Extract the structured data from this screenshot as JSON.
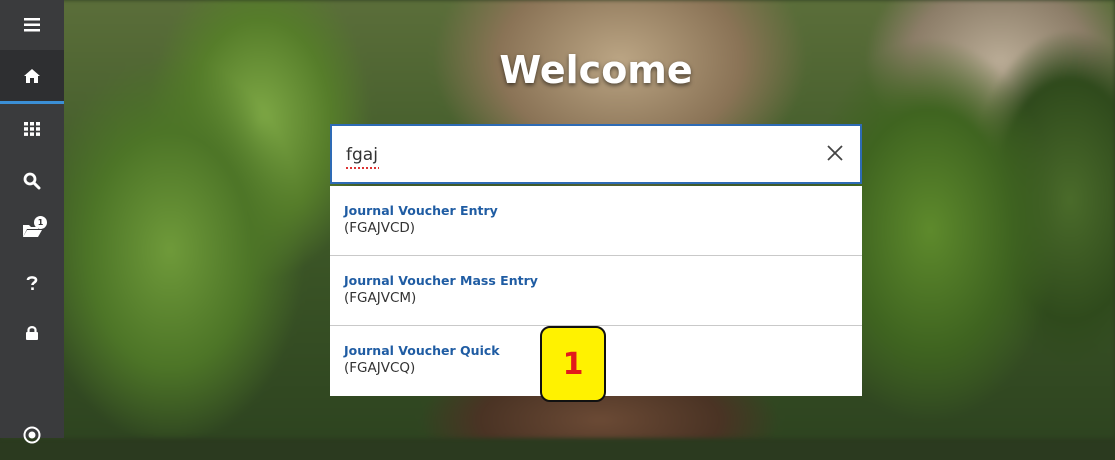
{
  "page": {
    "welcome_title": "Welcome"
  },
  "search": {
    "value": "fgaj",
    "clear_label": "×"
  },
  "results": [
    {
      "title": "Journal Voucher Entry",
      "code": "(FGAJVCD)"
    },
    {
      "title": "Journal Voucher Mass Entry",
      "code": "(FGAJVCM)"
    },
    {
      "title": "Journal Voucher Quick",
      "code": "(FGAJVCQ)"
    }
  ],
  "sidebar": {
    "items": [
      {
        "icon": "menu-icon"
      },
      {
        "icon": "home-icon",
        "active": true
      },
      {
        "icon": "apps-grid-icon"
      },
      {
        "icon": "search-icon"
      },
      {
        "icon": "folder-icon",
        "badge": "1"
      },
      {
        "icon": "help-icon"
      },
      {
        "icon": "lock-icon"
      },
      {
        "icon": "user-circle-icon"
      }
    ]
  },
  "callout": {
    "label": "1"
  },
  "colors": {
    "sidebar": "#3a3b3d",
    "accent": "#2e6bb5",
    "link": "#1f5ca3",
    "callout_fill": "#fff200",
    "callout_text": "#e21b1b"
  }
}
